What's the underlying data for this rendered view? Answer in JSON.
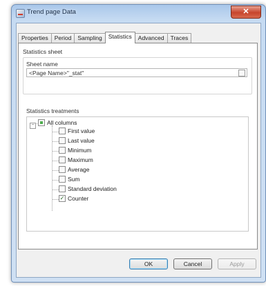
{
  "window": {
    "title": "Trend page Data",
    "close_label": "✕"
  },
  "tabs": [
    {
      "label": "Properties"
    },
    {
      "label": "Period"
    },
    {
      "label": "Sampling"
    },
    {
      "label": "Statistics",
      "active": true
    },
    {
      "label": "Advanced"
    },
    {
      "label": "Traces"
    }
  ],
  "statistics_sheet": {
    "group_label": "Statistics sheet",
    "sheet_name_label": "Sheet name",
    "sheet_name_value": "<Page Name>\"_stat\""
  },
  "statistics_treatments": {
    "group_label": "Statistics treatments",
    "root": {
      "label": "All columns",
      "state": "partial",
      "expander": "−"
    },
    "items": [
      {
        "label": "First value",
        "checked": false
      },
      {
        "label": "Last value",
        "checked": false
      },
      {
        "label": "Minimum",
        "checked": false
      },
      {
        "label": "Maximum",
        "checked": false
      },
      {
        "label": "Average",
        "checked": false
      },
      {
        "label": "Sum",
        "checked": false
      },
      {
        "label": "Standard deviation",
        "checked": false
      },
      {
        "label": "Counter",
        "checked": true
      }
    ]
  },
  "buttons": {
    "ok": "OK",
    "cancel": "Cancel",
    "apply": "Apply"
  }
}
